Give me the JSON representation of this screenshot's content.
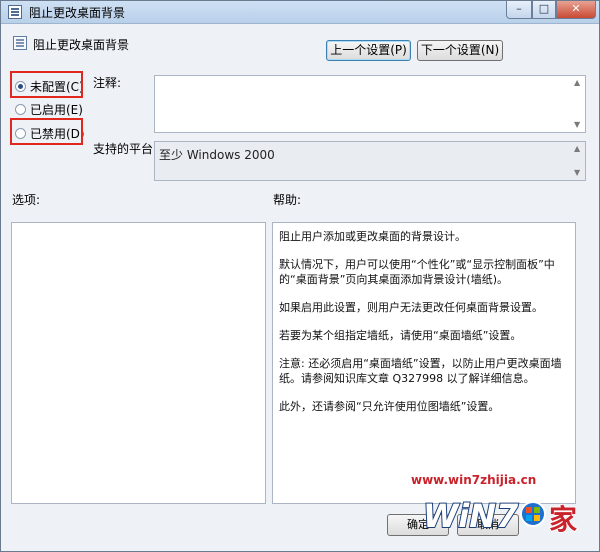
{
  "window": {
    "title": "阻止更改桌面背景",
    "min_glyph": "–",
    "max_glyph": "□",
    "close_glyph": "✕"
  },
  "header": {
    "setting_name": "阻止更改桌面背景",
    "prev_button": "上一个设置(P)",
    "next_button": "下一个设置(N)"
  },
  "state": {
    "options": [
      {
        "label": "未配置(C)",
        "checked": true
      },
      {
        "label": "已启用(E)",
        "checked": false
      },
      {
        "label": "已禁用(D)",
        "checked": false
      }
    ]
  },
  "comment": {
    "label": "注释:",
    "value": ""
  },
  "platform": {
    "label": "支持的平台:",
    "value": "至少 Windows 2000"
  },
  "options_panel": {
    "label": "选项:"
  },
  "help_panel": {
    "label": "帮助:",
    "paragraphs": [
      "阻止用户添加或更改桌面的背景设计。",
      "默认情况下，用户可以使用“个性化”或“显示控制面板”中的“桌面背景”页向其桌面添加背景设计(墙纸)。",
      "如果启用此设置，则用户无法更改任何桌面背景设置。",
      "若要为某个组指定墙纸，请使用“桌面墙纸”设置。",
      "注意: 还必须启用“桌面墙纸”设置，以防止用户更改桌面墙纸。请参阅知识库文章 Q327998 以了解详细信息。",
      "此外，还请参阅“只允许使用位图墙纸”设置。"
    ]
  },
  "footer": {
    "ok_button": "确定",
    "cancel_button": "取消"
  },
  "watermark": {
    "url": "www.win7zhijia.cn",
    "logo_text": "WiN7.家"
  },
  "colors": {
    "highlight_box": "#e0281f",
    "window_bg": "#eef2f7"
  }
}
